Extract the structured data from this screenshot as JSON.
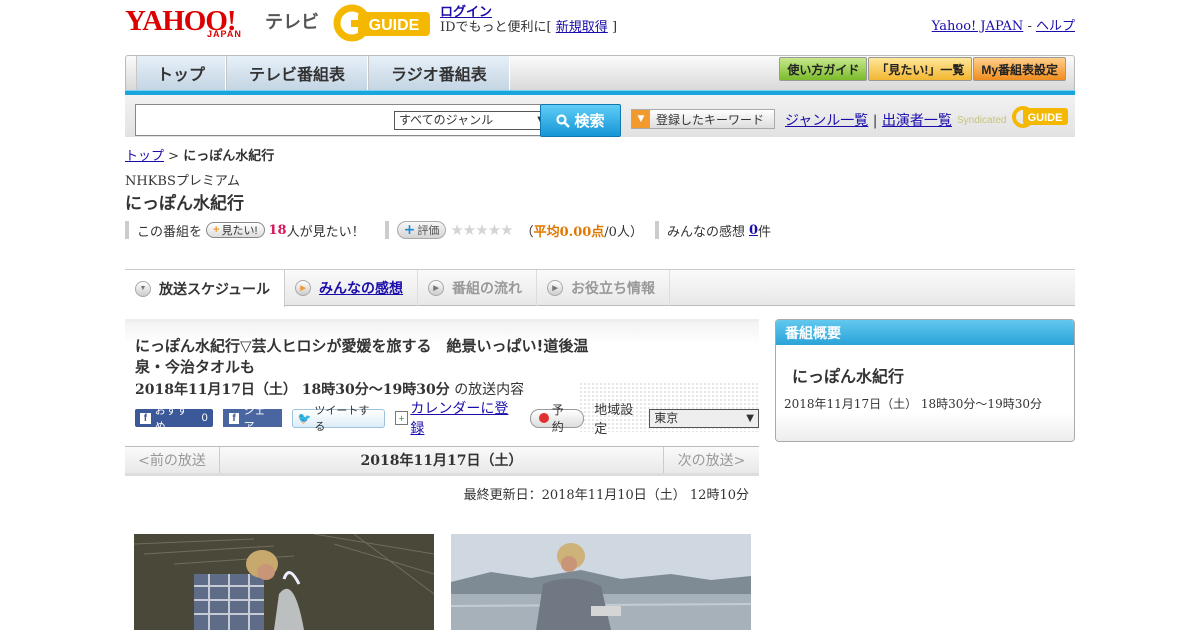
{
  "header": {
    "logo_text": "YAHOO!",
    "logo_sub": "JAPAN",
    "service_name": "テレビ",
    "gguide_logo": "GUIDE",
    "login": "ログイン",
    "login_note_pre": "IDでもっと便利に[",
    "signup": "新規取得",
    "login_note_post": "]",
    "yahoo_japan": "Yahoo! JAPAN",
    "dash": "-",
    "help": "ヘルプ"
  },
  "nav": {
    "tabs": [
      {
        "label": "トップ"
      },
      {
        "label": "テレビ番組表"
      },
      {
        "label": "ラジオ番組表"
      }
    ],
    "guide": "使い方ガイド",
    "mitai_list": "「見たい!」一覧",
    "my_settings": "My番組表設定"
  },
  "search": {
    "genre": "すべてのジャンル",
    "button": "検索",
    "keyword_button": "登録したキーワード",
    "genre_list": "ジャンル一覧",
    "divider": "|",
    "cast_list": "出演者一覧",
    "syndicated": "Syndicated",
    "syndicated_logo": "GUIDE"
  },
  "breadcrumb": {
    "top": "トップ",
    "separator": ">",
    "current": "にっぽん水紀行"
  },
  "program": {
    "channel": "NHKBSプレミアム",
    "title": "にっぽん水紀行"
  },
  "rating": {
    "prefix": "この番組を",
    "mitai_button": "見たい!",
    "mitai_count": "18",
    "mitai_suffix": "人が見たい！",
    "eval_button": "評価",
    "stars": "★★★★★",
    "avg_open": "（",
    "avg_label": "平均0.00点",
    "avg_count": "/0人）",
    "kansou_prefix": "みんなの感想",
    "kansou_count": "0",
    "kansou_suffix": "件"
  },
  "tabs": [
    {
      "label": "放送スケジュール"
    },
    {
      "label": "みんなの感想"
    },
    {
      "label": "番組の流れ"
    },
    {
      "label": "お役立ち情報"
    }
  ],
  "episode": {
    "title": "にっぽん水紀行▽芸人ヒロシが愛媛を旅する　絶景いっぱい!道後温泉・今治タオルも",
    "datetime": "2018年11月17日（土）  18時30分～19時30分",
    "suffix": "の放送内容",
    "fb_recommend": "おすすめ",
    "fb_count": "0",
    "fb_share": "シェア",
    "tweet": "ツイートする",
    "calendar": "カレンダーに登録",
    "reserve": "予約",
    "region_label": "地域設定",
    "region": "東京"
  },
  "pager": {
    "prev": "<前の放送",
    "current": "2018年11月17日（土）",
    "next": "次の放送>"
  },
  "updated": "最終更新日：2018年11月10日（土）  12時10分",
  "sidebar": {
    "heading": "番組概要",
    "title": "にっぽん水紀行",
    "datetime": "2018年11月17日（土）  18時30分～19時30分"
  }
}
